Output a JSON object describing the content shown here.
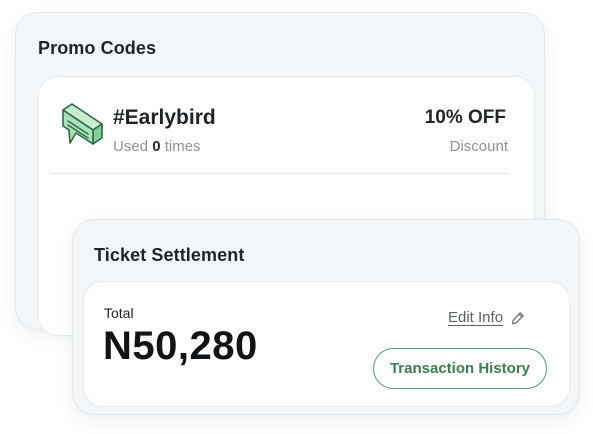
{
  "promo": {
    "title": "Promo Codes",
    "code": "#Earlybird",
    "usage_prefix": "Used",
    "usage_count": "0",
    "usage_suffix": "times",
    "discount_value": "10% OFF",
    "discount_label": "Discount",
    "icon": "ticket-icon"
  },
  "settlement": {
    "title": "Ticket Settlement",
    "total_label": "Total",
    "total_amount": "N50,280",
    "edit_label": "Edit Info",
    "edit_icon": "pencil-icon",
    "history_button": "Transaction History"
  },
  "colors": {
    "accent_green": "#3e7d56",
    "icon_green": "#a8e0b8",
    "title_text": "#1f2428",
    "muted_text": "#8d949a"
  }
}
